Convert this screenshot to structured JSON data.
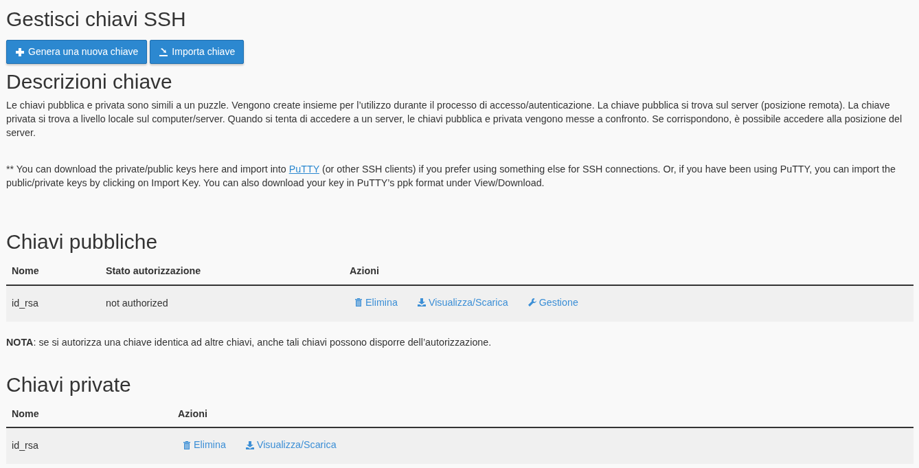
{
  "title": "Gestisci chiavi SSH",
  "buttons": [
    {
      "kind": "add",
      "label": "Genera una nuova chiave"
    },
    {
      "kind": "import",
      "label": "Importa chiave"
    }
  ],
  "description": {
    "heading": "Descrizioni chiave",
    "text": "Le chiavi pubblica e privata sono simili a un puzzle. Vengono create insieme per l’utilizzo durante il processo di accesso/autenticazione. La chiave pubblica si trova sul server (posizione remota). La chiave privata si trova a livello locale sul computer/server. Quando si tenta di accedere a un server, le chiavi pubblica e privata vengono messe a confronto. Se corrispondono, è possibile accedere alla posizione del server.",
    "note_before": "** You can download the private/public keys here and import into",
    "note_link": "PuTTY",
    "note_after": "(or other SSH clients) if you prefer using something else for SSH connections. Or, if you have been using PuTTY, you can import the public/private keys by clicking on Import Key. You can also download your key in PuTTY’s ppk format under View/Download."
  },
  "public_keys": {
    "heading": "Chiavi pubbliche",
    "columns": [
      "Nome",
      "Stato autorizzazione",
      "Azioni"
    ],
    "rows": [
      {
        "name": "id_rsa",
        "status": "not authorized",
        "actions": [
          {
            "kind": "delete",
            "label": "Elimina"
          },
          {
            "kind": "download",
            "label": "Visualizza/Scarica"
          },
          {
            "kind": "manage",
            "label": "Gestione"
          }
        ]
      }
    ],
    "note": "**NOTA**: se si autorizza una chiave identica ad altre chiavi, anche tali chiavi possono disporre dell’autorizzazione."
  },
  "private_keys": {
    "heading": "Chiavi private",
    "columns": [
      "Nome",
      "Azioni"
    ],
    "rows": [
      {
        "name": "id_rsa",
        "actions": [
          {
            "kind": "delete",
            "label": "Elimina"
          },
          {
            "kind": "download",
            "label": "Visualizza/Scarica"
          }
        ]
      }
    ]
  }
}
